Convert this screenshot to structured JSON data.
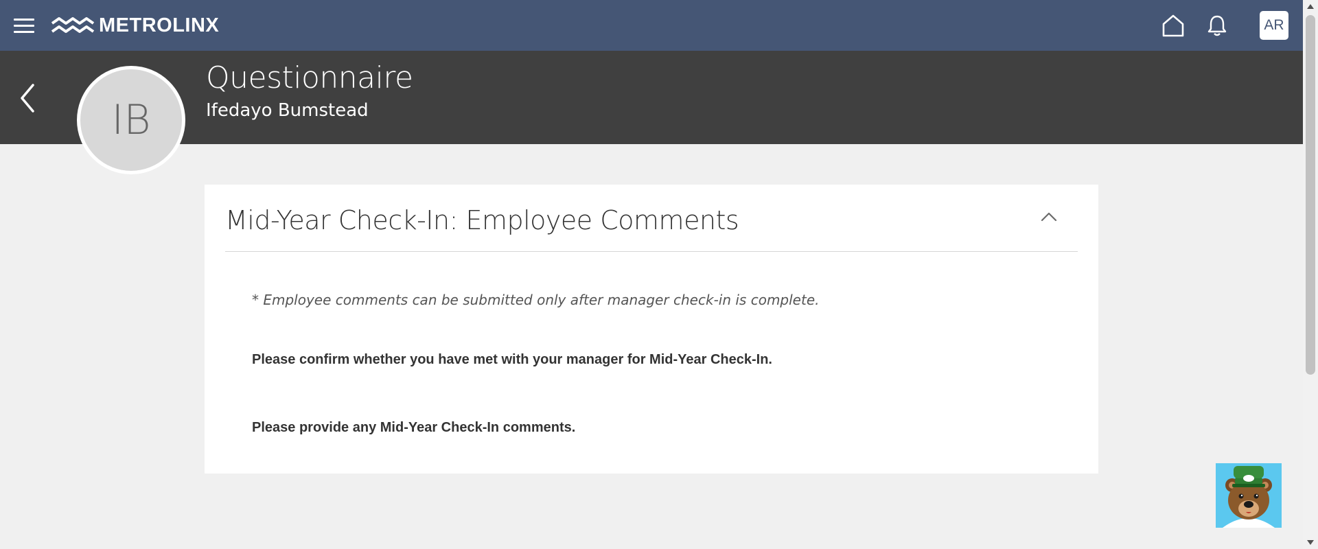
{
  "topbar": {
    "brand_name": "METROLINX",
    "menu_icon": "hamburger-menu-icon",
    "home_icon": "home-icon",
    "notifications_icon": "bell-icon",
    "user_initials": "AR",
    "background_color": "#455675"
  },
  "header": {
    "back_icon": "chevron-left-icon",
    "avatar_initials": "IB",
    "title": "Questionnaire",
    "subtitle": "Ifedayo Bumstead",
    "background_color": "#404040"
  },
  "card": {
    "title": "Mid-Year Check-In: Employee Comments",
    "collapse_icon": "chevron-up-icon",
    "note": "* Employee comments can be submitted only after manager check-in is complete.",
    "questions": [
      {
        "text": "Please confirm whether you have met with your manager for Mid-Year Check-In."
      },
      {
        "text": "Please provide any Mid-Year Check-In comments."
      }
    ]
  },
  "widgets": {
    "chat_mascot_icon": "bear-mascot-icon"
  }
}
